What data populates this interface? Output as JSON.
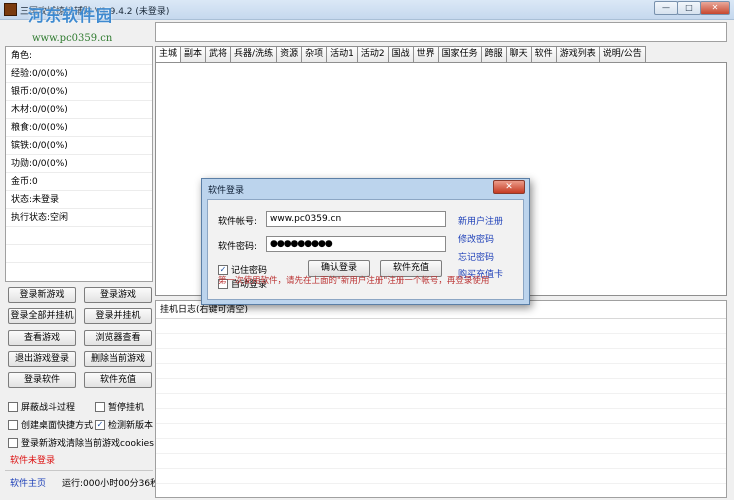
{
  "window": {
    "title": "三国攻城掠地辅助 V1.9.4.2 (未登录)",
    "controls": {
      "minimize": "—",
      "maximize": "□",
      "close": "✕"
    }
  },
  "watermark": {
    "text": "河东软件园",
    "url": "www.pc0359.cn"
  },
  "stats": [
    {
      "label": "角色:"
    },
    {
      "label": "经验:0/0(0%)"
    },
    {
      "label": "银币:0/0(0%)"
    },
    {
      "label": "木材:0/0(0%)"
    },
    {
      "label": "粮食:0/0(0%)"
    },
    {
      "label": "镔铁:0/0(0%)"
    },
    {
      "label": "功勋:0/0(0%)"
    },
    {
      "label": "金币:0"
    },
    {
      "label": "状态:未登录"
    },
    {
      "label": "执行状态:空闲"
    }
  ],
  "buttons": {
    "login_new_game": "登录新游戏",
    "login_game": "登录游戏",
    "login_all_hang": "登录全部并挂机",
    "login_hang": "登录并挂机",
    "view_game": "查看游戏",
    "browser_view": "浏览器查看",
    "exit_game_login": "退出游戏登录",
    "delete_current_game": "删除当前游戏",
    "login_software": "登录软件",
    "software_recharge": "软件充值"
  },
  "checkboxes": [
    {
      "label": "屏蔽战斗过程",
      "checked": false
    },
    {
      "label": "暂停挂机",
      "checked": false
    },
    {
      "label": "创建桌面快捷方式",
      "checked": false
    },
    {
      "label": "检测新版本",
      "checked": true,
      "mark": "✓"
    },
    {
      "label": "登录新游戏清除当前游戏cookies",
      "checked": false
    }
  ],
  "status_text": "软件未登录",
  "footer": {
    "home_link": "软件主页",
    "runtime": "运行:000小时00分36秒"
  },
  "tabs": [
    "主城",
    "副本",
    "武将",
    "兵器/洗练",
    "资源",
    "杂项",
    "活动1",
    "活动2",
    "国战",
    "世界",
    "国家任务",
    "跨服",
    "聊天",
    "软件",
    "游戏列表",
    "说明/公告"
  ],
  "active_tab": "主城",
  "log": {
    "header": "挂机日志(右键可清空)"
  },
  "dialog": {
    "title": "软件登录",
    "close": "✕",
    "account_label": "软件帐号:",
    "account_value": "www.pc0359.cn",
    "password_label": "软件密码:",
    "password_value": "●●●●●●●●●",
    "remember_label": "记住密码",
    "remember_mark": "✓",
    "auto_login_label": "自动登录",
    "confirm_button": "确认登录",
    "recharge_button": "软件充值",
    "links": [
      "新用户注册",
      "修改密码",
      "忘记密码",
      "购买充值卡"
    ],
    "note": "第一次使用软件，请先在上面的\"新用户注册\"注册一个帐号，再登录使用"
  },
  "colors": {
    "accent": "#1d3fb8",
    "warning": "#dd1111",
    "dialog_frame": "#bcd4ed"
  }
}
